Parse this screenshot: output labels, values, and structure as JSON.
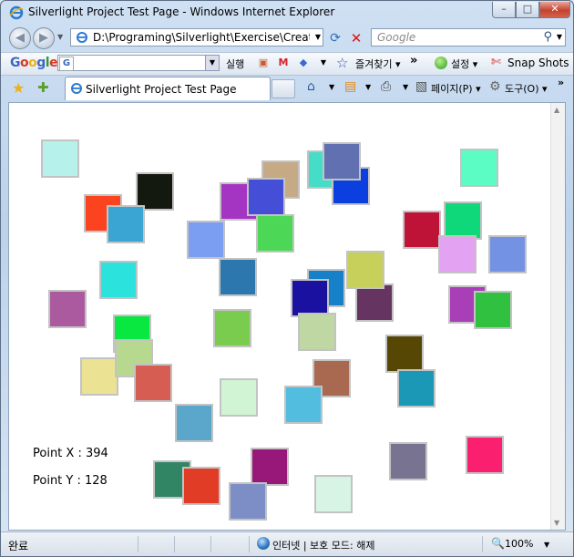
{
  "window": {
    "title": "Silverlight Project Test Page - Windows Internet Explorer",
    "minimize_glyph": "–",
    "maximize_glyph": "□",
    "close_glyph": "✕"
  },
  "address": {
    "url": "D:\\Programing\\Silverlight\\Exercise\\CreateObje",
    "search_placeholder": "Google"
  },
  "google_toolbar": {
    "logo": [
      "G",
      "o",
      "o",
      "g",
      "l",
      "e"
    ],
    "run_label": "실행",
    "mail_glyph": "M",
    "favorites_label": "즐겨찾기",
    "more_glyph": "»",
    "settings_label": "설정",
    "snapshots_label": "Snap Shots"
  },
  "tabs": [
    {
      "label": "Silverlight Project Test Page"
    }
  ],
  "commands": {
    "page_label": "페이지(P)",
    "tools_label": "도구(O)",
    "more_glyph": "»"
  },
  "content": {
    "point_x_label": "Point X : 394",
    "point_y_label": "Point Y : 128",
    "squares": [
      {
        "color": "#b7f1ec"
      },
      {
        "color": "#c6aa86"
      },
      {
        "color": "#46ddc8"
      },
      {
        "color": "#0b3fe0"
      },
      {
        "color": "#6170b0"
      },
      {
        "color": "#5cfdc5"
      },
      {
        "color": "#fb441f"
      },
      {
        "color": "#13190e"
      },
      {
        "color": "#3aa4d2"
      },
      {
        "color": "#a435c3"
      },
      {
        "color": "#444ed6"
      },
      {
        "color": "#7b9ef2"
      },
      {
        "color": "#4cd856"
      },
      {
        "color": "#be1336"
      },
      {
        "color": "#0ed87a"
      },
      {
        "color": "#e3a2f2"
      },
      {
        "color": "#7392e4"
      },
      {
        "color": "#2be3dc"
      },
      {
        "color": "#2c78ae"
      },
      {
        "color": "#1681c9"
      },
      {
        "color": "#653460"
      },
      {
        "color": "#c8d05c"
      },
      {
        "color": "#ab5aa0"
      },
      {
        "color": "#1a11a0"
      },
      {
        "color": "#a93fb7"
      },
      {
        "color": "#30c140"
      },
      {
        "color": "#08e840"
      },
      {
        "color": "#7acc4e"
      },
      {
        "color": "#bfd7a3"
      },
      {
        "color": "#574705"
      },
      {
        "color": "#ebe393"
      },
      {
        "color": "#b7d88f"
      },
      {
        "color": "#d55d52"
      },
      {
        "color": "#a96951"
      },
      {
        "color": "#d1f4d5"
      },
      {
        "color": "#53bde0"
      },
      {
        "color": "#1a98b5"
      },
      {
        "color": "#5ba6cb"
      },
      {
        "color": "#971878"
      },
      {
        "color": "#777390"
      },
      {
        "color": "#fa1f6f"
      },
      {
        "color": "#318565"
      },
      {
        "color": "#e13d26"
      },
      {
        "color": "#7c8ec5"
      },
      {
        "color": "#d8f4e5"
      }
    ]
  },
  "status": {
    "done_label": "완료",
    "zone_label": "인터넷 | 보호 모드: 해제",
    "zoom_label": "100%"
  }
}
